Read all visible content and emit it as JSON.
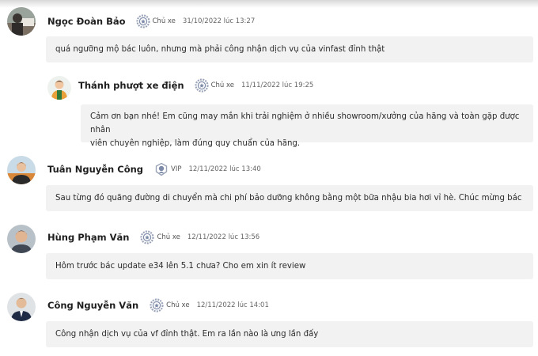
{
  "comments": [
    {
      "name": "Ngọc Đoàn Bảo",
      "role": "Chủ xe",
      "date": "31/10/2022 lúc 13:27",
      "text": "quá ngưỡng mộ bác luôn, nhưng mà phải công nhận dịch vụ của vinfast đỉnh thật",
      "badge_icon": "gear-badge-icon"
    },
    {
      "name": "Thánh phượt xe điện",
      "role": "Chủ xe",
      "date": "11/11/2022 lúc 19:25",
      "text_line1": "Cảm ơn bạn nhé! Em cũng may mắn khi trải nghiệm ở nhiều showroom/xưởng của hãng và toàn gặp được nhân",
      "text_line2": "viên chuyên nghiệp, làm đúng quy chuẩn của hãng.",
      "badge_icon": "gear-badge-icon"
    },
    {
      "name": "Tuân Nguyễn Công",
      "role": "VIP",
      "date": "12/11/2022 lúc 13:40",
      "text": "Sau từng đó quãng đường di chuyển mà chi phí bảo dưỡng không bằng một bữa nhậu bia hơi vỉ hè. Chúc mừng bác",
      "badge_icon": "vip-badge-icon"
    },
    {
      "name": "Hùng Phạm Văn",
      "role": "Chủ xe",
      "date": "12/11/2022 lúc 13:56",
      "text": "Hôm trước bác update e34 lên 5.1 chưa? Cho em xin ít review",
      "badge_icon": "gear-badge-icon"
    },
    {
      "name": "Công Nguyễn Văn",
      "role": "Chủ xe",
      "date": "12/11/2022 lúc 14:01",
      "text": "Công nhận dịch vụ của vf đỉnh thật. Em ra lần nào là ưng lần đấy",
      "badge_icon": "gear-badge-icon"
    }
  ],
  "colors": {
    "bubble": "#f2f2f2",
    "badge": "#7d8aa8"
  }
}
